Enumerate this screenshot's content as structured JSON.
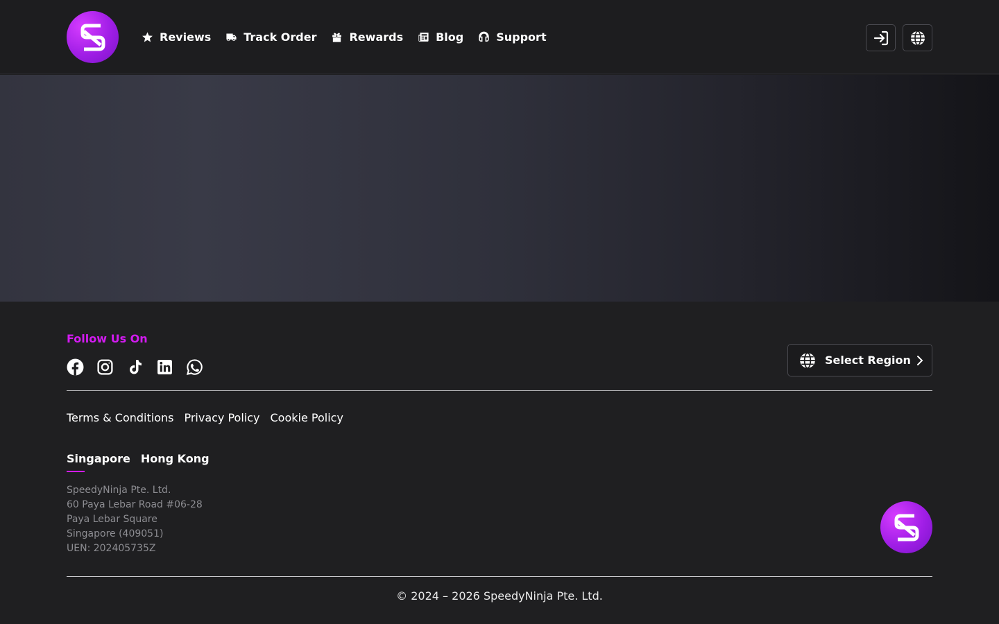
{
  "header": {
    "nav": [
      {
        "label": "Reviews",
        "icon": "star-icon"
      },
      {
        "label": "Track Order",
        "icon": "truck-icon"
      },
      {
        "label": "Rewards",
        "icon": "gift-icon"
      },
      {
        "label": "Blog",
        "icon": "newspaper-icon"
      },
      {
        "label": "Support",
        "icon": "headset-icon"
      }
    ],
    "login_icon": "sign-in-icon",
    "language_icon": "globe-icon"
  },
  "footer": {
    "follow_title": "Follow Us On",
    "socials": [
      "facebook-icon",
      "instagram-icon",
      "tiktok-icon",
      "linkedin-icon",
      "whatsapp-icon"
    ],
    "region_button": "Select Region",
    "links": [
      "Terms & Conditions",
      "Privacy Policy",
      "Cookie Policy"
    ],
    "tabs": [
      "Singapore",
      "Hong Kong"
    ],
    "active_tab": "Singapore",
    "address": [
      "SpeedyNinja Pte. Ltd.",
      "60 Paya Lebar Road #06-28",
      "Paya Lebar Square",
      "Singapore (409051)",
      "UEN: 202405735Z"
    ],
    "copyright": "© 2024 – 2026 SpeedyNinja Pte. Ltd."
  },
  "colors": {
    "accent": "#d21bf0",
    "background": "#1f1f21"
  }
}
